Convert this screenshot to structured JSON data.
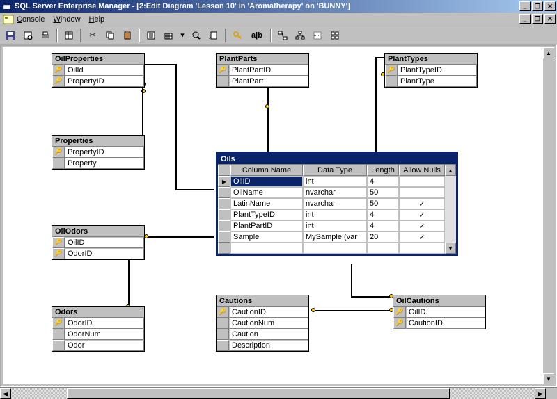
{
  "window": {
    "title": "SQL Server Enterprise Manager - [2:Edit Diagram 'Lesson 10' in 'Aromatherapy' on 'BUNNY']"
  },
  "menu": {
    "console": "Console",
    "window": "Window",
    "help": "Help"
  },
  "toolbar": {
    "ab_label": "a|b"
  },
  "tables": {
    "oilproperties": {
      "title": "OilProperties",
      "cols": [
        "OilId",
        "PropertyID"
      ]
    },
    "properties": {
      "title": "Properties",
      "cols": [
        "PropertyID",
        "Property"
      ]
    },
    "oilodors": {
      "title": "OilOdors",
      "cols": [
        "OilID",
        "OdorID"
      ]
    },
    "odors": {
      "title": "Odors",
      "cols": [
        "OdorID",
        "OdorNum",
        "Odor"
      ]
    },
    "plantparts": {
      "title": "PlantParts",
      "cols": [
        "PlantPartID",
        "PlantPart"
      ]
    },
    "planttypes": {
      "title": "PlantTypes",
      "cols": [
        "PlantTypeID",
        "PlantType"
      ]
    },
    "cautions": {
      "title": "Cautions",
      "cols": [
        "CautionID",
        "CautionNum",
        "Caution",
        "Description"
      ]
    },
    "oilcautions": {
      "title": "OilCautions",
      "cols": [
        "OilID",
        "CautionID"
      ]
    }
  },
  "oils": {
    "title": "Oils",
    "headers": [
      "Column Name",
      "Data Type",
      "Length",
      "Allow Nulls"
    ],
    "rows": [
      {
        "name": "OilID",
        "type": "int",
        "len": "4",
        "null": ""
      },
      {
        "name": "OilName",
        "type": "nvarchar",
        "len": "50",
        "null": ""
      },
      {
        "name": "LatinName",
        "type": "nvarchar",
        "len": "50",
        "null": "✓"
      },
      {
        "name": "PlantTypeID",
        "type": "int",
        "len": "4",
        "null": "✓"
      },
      {
        "name": "PlantPartID",
        "type": "int",
        "len": "4",
        "null": "✓"
      },
      {
        "name": "Sample",
        "type": "MySample (var",
        "len": "20",
        "null": "✓"
      }
    ]
  }
}
